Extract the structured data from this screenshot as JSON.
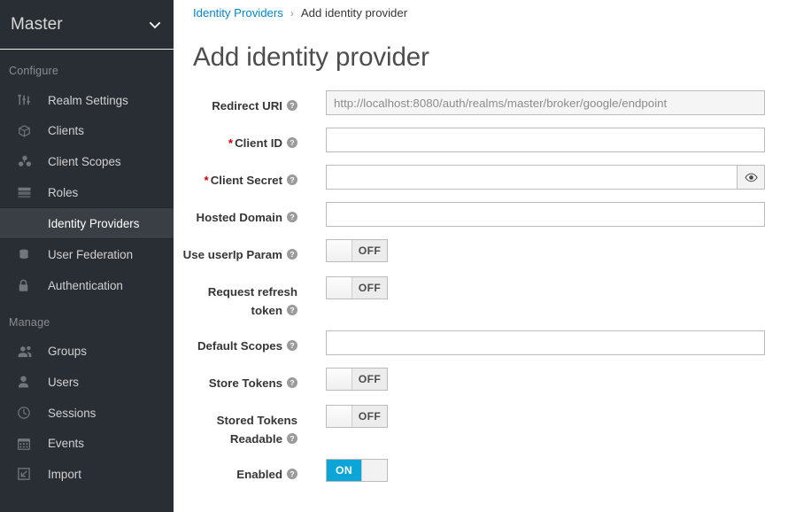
{
  "sidebar": {
    "realm": {
      "name": "Master",
      "caret_icon": "chevron-down-icon"
    },
    "sections": [
      {
        "title": "Configure",
        "items": [
          {
            "label": "Realm Settings",
            "icon": "sliders-icon",
            "active": false
          },
          {
            "label": "Clients",
            "icon": "cube-icon",
            "active": false
          },
          {
            "label": "Client Scopes",
            "icon": "cubes-icon",
            "active": false
          },
          {
            "label": "Roles",
            "icon": "list-icon",
            "active": false
          },
          {
            "label": "Identity Providers",
            "icon": "exchange-icon",
            "active": true
          },
          {
            "label": "User Federation",
            "icon": "database-icon",
            "active": false
          },
          {
            "label": "Authentication",
            "icon": "lock-icon",
            "active": false
          }
        ]
      },
      {
        "title": "Manage",
        "items": [
          {
            "label": "Groups",
            "icon": "users-icon",
            "active": false
          },
          {
            "label": "Users",
            "icon": "user-icon",
            "active": false
          },
          {
            "label": "Sessions",
            "icon": "clock-icon",
            "active": false
          },
          {
            "label": "Events",
            "icon": "calendar-icon",
            "active": false
          },
          {
            "label": "Import",
            "icon": "import-icon",
            "active": false
          }
        ]
      }
    ]
  },
  "breadcrumb": {
    "parent": "Identity Providers",
    "separator": "›",
    "current": "Add identity provider"
  },
  "page": {
    "title": "Add identity provider"
  },
  "form": {
    "fields": [
      {
        "label": "Redirect URI",
        "required": false,
        "type": "text",
        "value": "",
        "placeholder": "http://localhost:8080/auth/realms/master/broker/google/endpoint",
        "readonly": true,
        "help_icon": "help-circle-icon"
      },
      {
        "label": "Client ID",
        "required": true,
        "type": "text",
        "value": "",
        "placeholder": "",
        "readonly": false,
        "help_icon": "help-circle-icon"
      },
      {
        "label": "Client Secret",
        "required": true,
        "type": "password",
        "value": "",
        "placeholder": "",
        "readonly": false,
        "reveal_icon": "eye-icon",
        "help_icon": "help-circle-icon"
      },
      {
        "label": "Hosted Domain",
        "required": false,
        "type": "text",
        "value": "",
        "placeholder": "",
        "readonly": false,
        "help_icon": "help-circle-icon"
      },
      {
        "label": "Use userIp Param",
        "required": false,
        "type": "switch",
        "state": "OFF",
        "help_icon": "help-circle-icon"
      },
      {
        "label": "Request refresh token",
        "required": false,
        "type": "switch",
        "state": "OFF",
        "help_icon": "help-circle-icon"
      },
      {
        "label": "Default Scopes",
        "required": false,
        "type": "text",
        "value": "",
        "placeholder": "",
        "readonly": false,
        "help_icon": "help-circle-icon"
      },
      {
        "label": "Store Tokens",
        "required": false,
        "type": "switch",
        "state": "OFF",
        "help_icon": "help-circle-icon"
      },
      {
        "label": "Stored Tokens Readable",
        "required": false,
        "type": "switch",
        "state": "OFF",
        "help_icon": "help-circle-icon"
      },
      {
        "label": "Enabled",
        "required": false,
        "type": "switch",
        "state": "ON",
        "help_icon": "help-circle-icon"
      }
    ]
  },
  "colors": {
    "sidebar_bg": "#292e34",
    "sidebar_active_bg": "#393f44",
    "accent_link": "#0088ce",
    "switch_on": "#0ba6d7",
    "required_star": "#cc0000"
  }
}
